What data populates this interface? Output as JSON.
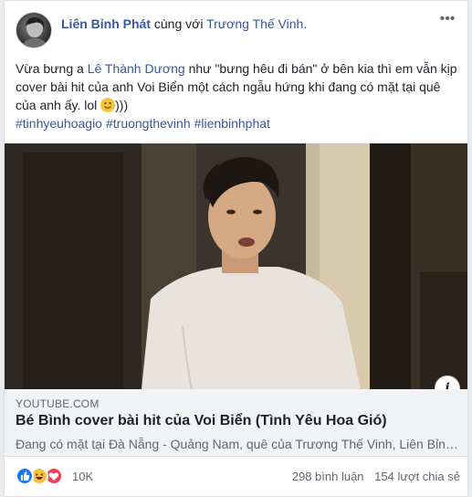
{
  "post": {
    "author": "Liên Bỉnh Phát",
    "with_text": "cùng với",
    "tagged": "Trương Thế Vinh.",
    "menu_icon": "more-icon",
    "text_1": "Vừa bưng a ",
    "mention": "Lê Thành Dương",
    "text_2": " như \"bưng hêu đi bán\" ở bên kia thì em vẫn kịp cover bài hit của anh Voi Biển một cách ngẫu hứng khi đang có mặt tại quê của anh ấy. lol ",
    "text_3": ")))",
    "hashtags": [
      "#tinhyeuhoagio",
      "#truongthevinh",
      "#lienbinhphat"
    ]
  },
  "link_preview": {
    "source": "YOUTUBE.COM",
    "title": "Bé Bình cover bài hit của Voi Biển (Tình Yêu Hoa Gió)",
    "description": "Đang có mặt tại Đà Nẵng - Quảng Nam, quê của Trương Thế Vinh, Liên Bỉnh Phát",
    "info_icon": "i"
  },
  "footer": {
    "reaction_count": "10K",
    "comments": "298 bình luận",
    "shares": "154 lượt chia sẻ",
    "reactions": [
      "like-icon",
      "haha-icon",
      "love-icon"
    ]
  },
  "colors": {
    "link": "#385898",
    "like": "#1877f2",
    "haha": "#f7c53b",
    "love": "#f33e58"
  }
}
